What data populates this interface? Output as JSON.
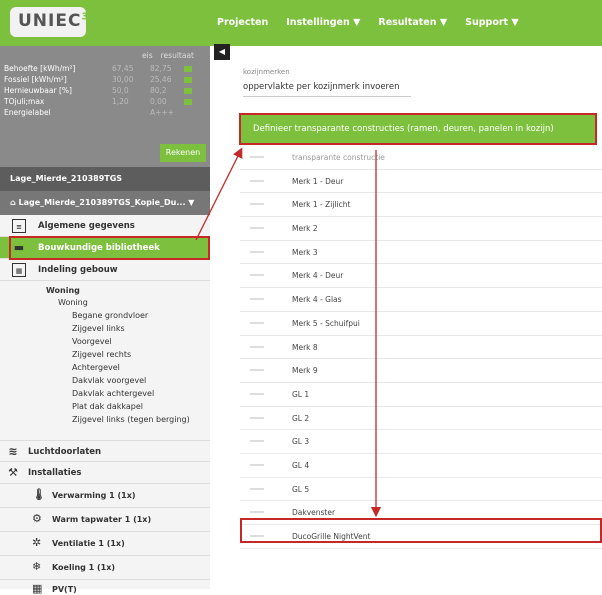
{
  "app": {
    "logo_text": "UNIEC",
    "logo_sup": "3",
    "nav": [
      {
        "label": "Projecten",
        "caret": ""
      },
      {
        "label": "Instellingen",
        "caret": "▼"
      },
      {
        "label": "Resultaten",
        "caret": "▼"
      },
      {
        "label": "Support",
        "caret": "▼"
      }
    ]
  },
  "summary": {
    "col_eis": "eis",
    "col_resultaat": "resultaat",
    "rows": [
      {
        "key": "Behoefte [kWh/m²]",
        "eis": "67,45",
        "res": "82,75"
      },
      {
        "key": "Fossiel [kWh/m²]",
        "eis": "30,00",
        "res": "25,46"
      },
      {
        "key": "Hernieuwbaar [%]",
        "eis": "50,0",
        "res": "80,2"
      },
      {
        "key": "TOjuli;max",
        "eis": "1,20",
        "res": "0,00"
      },
      {
        "key": "Energielabel",
        "eis": "",
        "res": "A+++"
      }
    ],
    "rekenen": "Rekenen"
  },
  "project": {
    "name": "Lage_Mierde_210389TGS",
    "variant": "Lage_Mierde_210389TGS_Kopie_Du..."
  },
  "menu": {
    "algemene": "Algemene gegevens",
    "bouwkundige": "Bouwkundige bibliotheek",
    "indeling": "Indeling gebouw",
    "woning1": "Woning",
    "woning2": "Woning",
    "zones": [
      "Begane grondvloer",
      "Zijgevel links",
      "Voorgevel",
      "Zijgevel rechts",
      "Achtergevel",
      "Dakvlak voorgevel",
      "Dakvlak achtergevel",
      "Plat dak dakkapel",
      "Zijgevel links (tegen berging)"
    ],
    "lucht": "Luchtdoorlaten",
    "installaties": "Installaties",
    "inst_items": [
      "Verwarming 1 (1x)",
      "Warm tapwater 1 (1x)",
      "Ventilatie 1 (1x)",
      "Koeling 1 (1x)",
      "PV(T)"
    ]
  },
  "main": {
    "field_label": "kozijnmerken",
    "field_value": "oppervlakte per kozijnmerk invoeren",
    "define_button": "Definieer transparante constructies (ramen, deuren, panelen in kozijn)",
    "table_header": "transparante constructie",
    "rows": [
      "Merk 1 - Deur",
      "Merk 1 - Zijlicht",
      "Merk 2",
      "Merk 3",
      "Merk 4 - Deur",
      "Merk 4 - Glas",
      "Merk 5 - Schuifpui",
      "Merk 8",
      "Merk 9",
      "GL 1",
      "GL 2",
      "GL 3",
      "GL 4",
      "GL 5",
      "Dakvenster",
      "DucoGrille NightVent"
    ]
  },
  "icons": {
    "collapse": "◀",
    "home": "⌂",
    "doc": "≡",
    "bricks": "▬",
    "grid": "▦",
    "wind": "≋",
    "install": "⚒",
    "thermo": "🌡",
    "tap": "⚙",
    "fan": "✲",
    "snow": "❄",
    "pv": "▦"
  },
  "colors": {
    "accent": "#7dc03d",
    "highlight": "#c62828"
  }
}
